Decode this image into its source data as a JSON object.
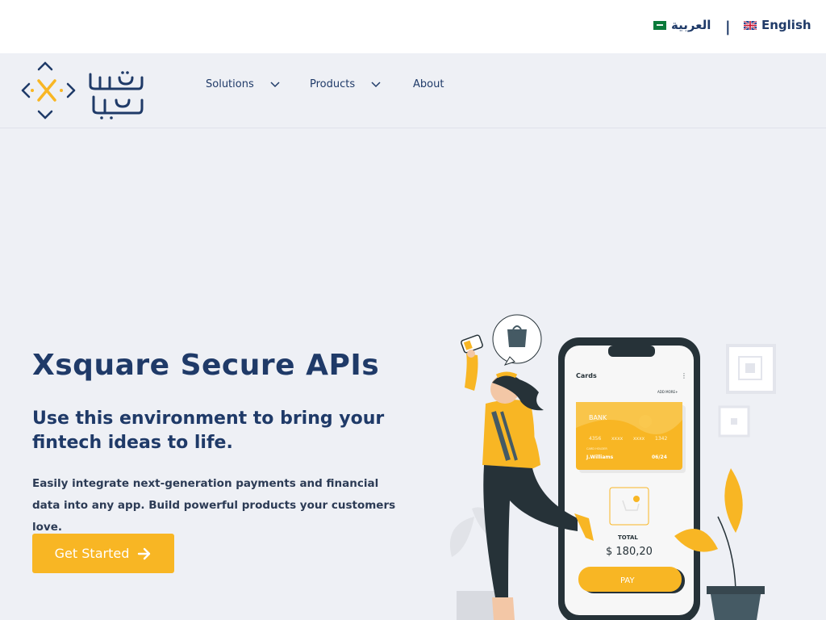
{
  "language_bar": {
    "arabic_label": "العربية",
    "separator": "|",
    "english_label": "English"
  },
  "nav": {
    "logo_icon": "xsquare-logo",
    "items": [
      {
        "label": "Solutions",
        "has_dropdown": true
      },
      {
        "label": "Products",
        "has_dropdown": true
      },
      {
        "label": "About",
        "has_dropdown": false
      }
    ]
  },
  "hero": {
    "title": "Xsquare Secure APIs",
    "subtitle": "Use this environment to bring your fintech ideas to life.",
    "description": "Easily integrate next-generation payments and financial data into any app. Build powerful products your customers love.",
    "cta_label": "Get Started",
    "cta_icon": "arrow-right-icon"
  },
  "illustration": {
    "phone_header": "Cards",
    "add_more": "ADD MORE+",
    "card_bank": "BANK",
    "card_number": [
      "4356",
      "xxxx",
      "xxxx",
      "1342"
    ],
    "card_holder_label": "CARD HOLDER",
    "card_holder": "J.Williams",
    "card_expiry": "06/24",
    "total_label": "TOTAL",
    "total_amount": "$ 180,20",
    "pay_label": "PAY"
  },
  "colors": {
    "primary": "#1f3a68",
    "accent": "#f8b624",
    "background": "#eef0f5"
  }
}
